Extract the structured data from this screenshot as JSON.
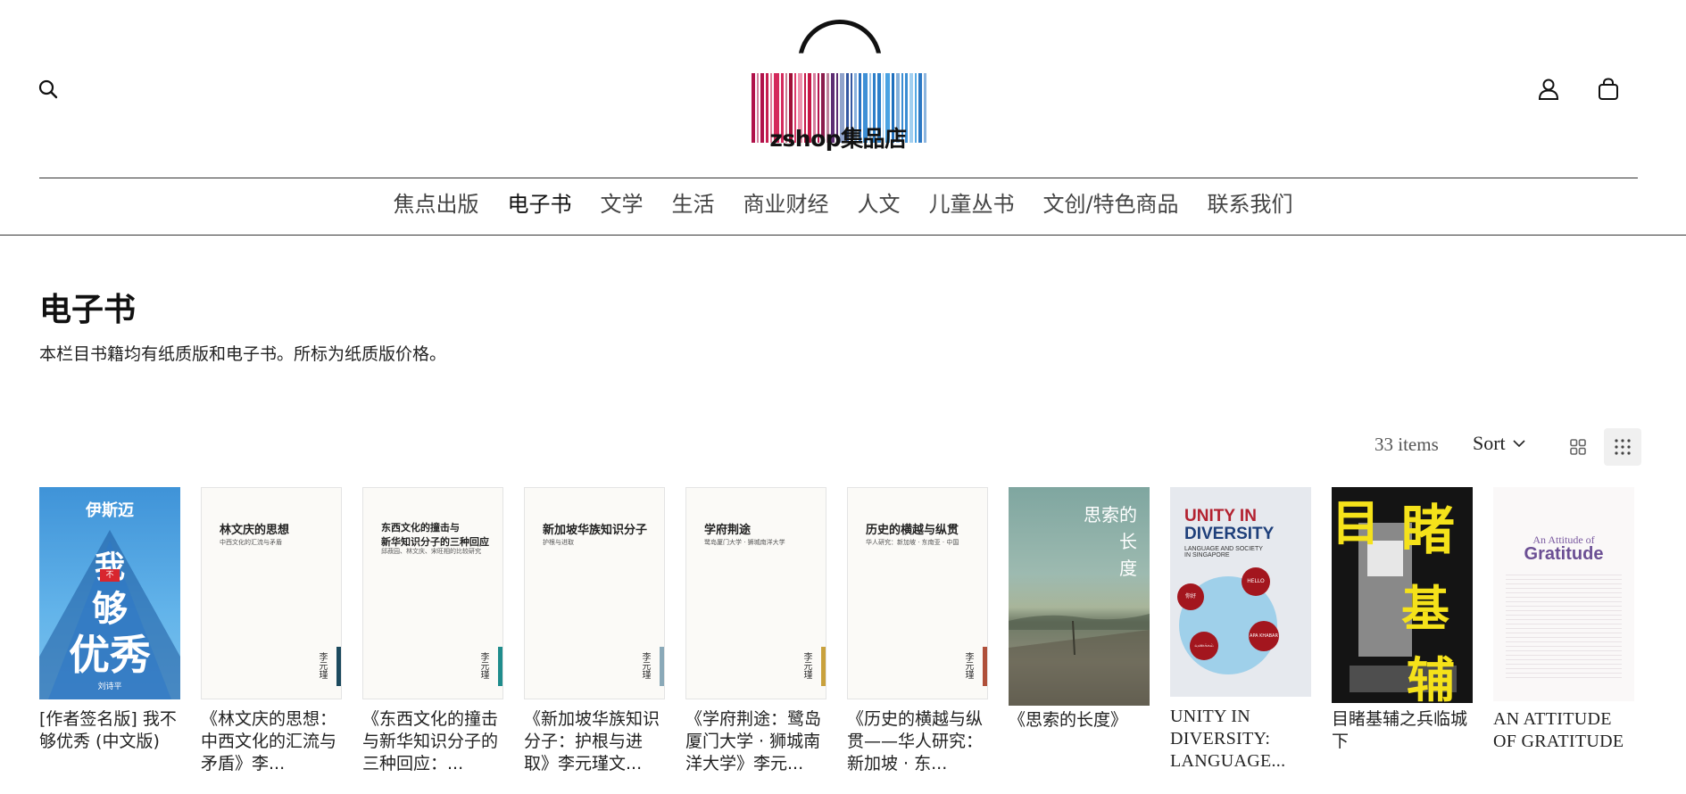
{
  "header": {
    "logo_text": "zshop集品店",
    "logo_bar_colors": [
      "#b0124a",
      "#c71d4f",
      "#d42a5c",
      "#9f1038",
      "#e03b6c",
      "#c51747",
      "#b5124c",
      "#8b1d4d",
      "#5d2d73",
      "#3457a1",
      "#2a73c2",
      "#3e90d6",
      "#2d7fc9",
      "#4aa3e3",
      "#1f6fbd",
      "#3a8dd3",
      "#53a8e4",
      "#2b78c4"
    ]
  },
  "nav": {
    "items": [
      {
        "label": "焦点出版"
      },
      {
        "label": "电子书"
      },
      {
        "label": "文学"
      },
      {
        "label": "生活"
      },
      {
        "label": "商业财经"
      },
      {
        "label": "人文"
      },
      {
        "label": "儿童丛书"
      },
      {
        "label": "文创/特色商品"
      },
      {
        "label": "联系我们"
      }
    ]
  },
  "page": {
    "title": "电子书",
    "description": "本栏目书籍均有纸质版和电子书。所标为纸质版价格。"
  },
  "toolbar": {
    "items_count": "33 items",
    "sort_label": "Sort"
  },
  "products": [
    {
      "title": "[作者签名版] 我不够优秀 (中文版)",
      "cover": {
        "top": "伊斯迈",
        "main1": "我",
        "main2": "够",
        "main3": "优秀",
        "badge": "不",
        "author": "刘诗平"
      }
    },
    {
      "title": "《林文庆的思想：中西文化的汇流与矛盾》李...",
      "cover": {
        "title": "林文庆的思想",
        "subtitle": "中西文化的汇流与矛盾",
        "author": "李元瑾",
        "band": "#1c4a5e"
      }
    },
    {
      "title": "《东西文化的撞击与新华知识分子的三种回应：...",
      "cover": {
        "title": "东西文化的撞击与\n新华知识分子的三种回应",
        "subtitle": "邱菽园、林文庆、宋旺相的比较研究",
        "author": "李元瑾",
        "band": "#1f8c8c"
      }
    },
    {
      "title": "《新加坡华族知识分子：护根与进取》李元瑾文...",
      "cover": {
        "title": "新加坡华族知识分子",
        "subtitle": "护根与进取",
        "author": "李元瑾",
        "band": "#8aa9b8"
      }
    },
    {
      "title": "《学府荆途：鹭岛厦门大学 · 狮城南洋大学》李元...",
      "cover": {
        "title": "学府荆途",
        "subtitle": "鹭岛厦门大学 · 狮城南洋大学",
        "author": "李元瑾",
        "band": "#c9a13c"
      }
    },
    {
      "title": "《历史的横越与纵贯——华人研究：新加坡 · 东...",
      "cover": {
        "title": "历史的横越与纵贯",
        "subtitle": "华人研究：新加坡 · 东南亚 · 中国",
        "author": "李元瑾",
        "band": "#b0503a"
      }
    },
    {
      "title": "《思索的长度》",
      "cover": {
        "title": "思索的\n长\n度"
      }
    },
    {
      "title": "UNITY IN DIVERSITY: LANGUAGE...",
      "cover": {
        "title1": "UNITY IN",
        "title2": "DIVERSITY",
        "subtitle": "LANGUAGE AND SOCIETY\nIN SINGAPORE",
        "b1": "你好",
        "b2": "HELLO",
        "b3": "APA KHABAR",
        "b4": "வணக்கம்"
      }
    },
    {
      "title": "目睹基辅之兵临城下",
      "cover": {
        "t1": "目",
        "t2": "睹",
        "t3": "基",
        "t4": "辅"
      }
    },
    {
      "title": "AN ATTITUDE OF GRATITUDE",
      "cover": {
        "t1": "An Attitude of",
        "t2": "Gratitude"
      }
    }
  ]
}
